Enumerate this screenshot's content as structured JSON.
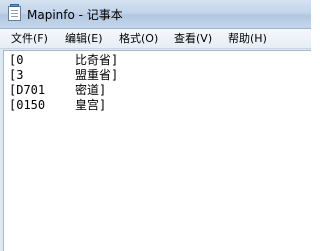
{
  "window": {
    "title": "Mapinfo - 记事本",
    "icon": "notepad-icon"
  },
  "menu": {
    "items": [
      {
        "label": "文件(F)"
      },
      {
        "label": "编辑(E)"
      },
      {
        "label": "格式(O)"
      },
      {
        "label": "查看(V)"
      },
      {
        "label": "帮助(H)"
      }
    ]
  },
  "editor": {
    "lines": [
      {
        "code": "[0",
        "name": "比奇省]"
      },
      {
        "code": "[3",
        "name": "盟重省]"
      },
      {
        "code": "[D701",
        "name": "密道]"
      },
      {
        "code": "[0150",
        "name": "皇宫]"
      }
    ]
  }
}
